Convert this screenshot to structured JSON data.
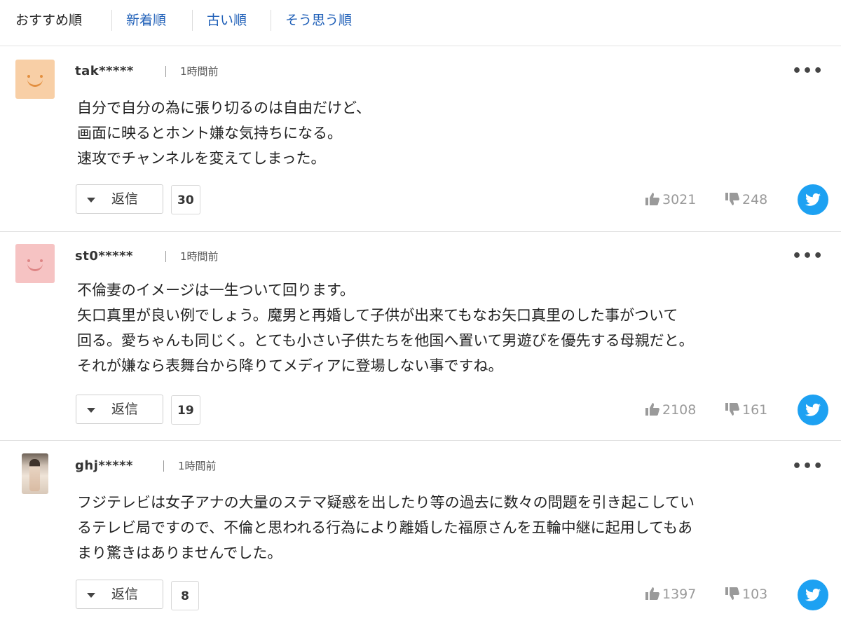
{
  "sort_tabs": [
    {
      "label": "おすすめ順"
    },
    {
      "label": "新着順"
    },
    {
      "label": "古い順"
    },
    {
      "label": "そう思う順"
    }
  ],
  "colors": {
    "link": "#2060b8",
    "twitter": "#1da1f2",
    "vote_gray": "#9a9a9a"
  },
  "comments": [
    {
      "username": "tak*****",
      "time": "1時間前",
      "avatar": "orange-smiley-icon",
      "text": "自分で自分の為に張り切るのは自由だけど、\n画面に映るとホント嫌な気持ちになる。\n速攻でチャンネルを変えてしまった。",
      "reply_label": "返信",
      "reply_count": "30",
      "likes": "3021",
      "dislikes": "248"
    },
    {
      "username": "st0*****",
      "time": "1時間前",
      "avatar": "pink-smiley-icon",
      "text": "不倫妻のイメージは一生ついて回ります。\n矢口真里が良い例でしょう。魔男と再婚して子供が出来てもなお矢口真里のした事がついて\n回る。愛ちゃんも同じく。とても小さい子供たちを他国へ置いて男遊びを優先する母親だと。\nそれが嫌なら表舞台から降りてメディアに登場しない事ですね。",
      "reply_label": "返信",
      "reply_count": "19",
      "likes": "2108",
      "dislikes": "161"
    },
    {
      "username": "ghj*****",
      "time": "1時間前",
      "avatar": "photo-avatar",
      "text": "フジテレビは女子アナの大量のステマ疑惑を出したり等の過去に数々の問題を引き起こしてい\nるテレビ局ですので、不倫と思われる行為により離婚した福原さんを五輪中継に起用してもあ\nまり驚きはありませんでした。",
      "reply_label": "返信",
      "reply_count": "8",
      "likes": "1397",
      "dislikes": "103"
    }
  ]
}
